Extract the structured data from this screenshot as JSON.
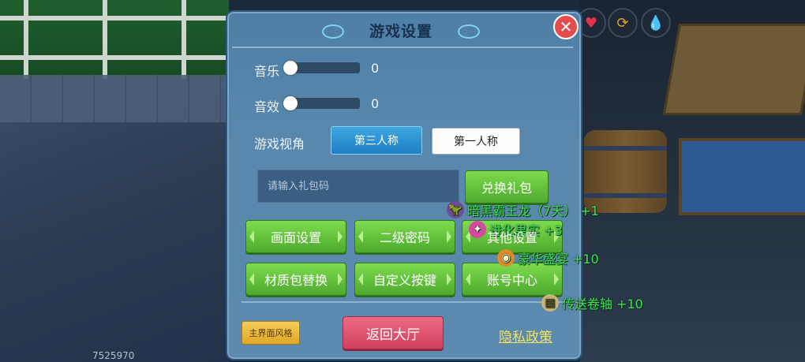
{
  "background": {
    "code_text": "7525970"
  },
  "hud": {
    "icons": [
      "heart-icon",
      "swap-icon",
      "drop-icon"
    ]
  },
  "dialog": {
    "title": "游戏设置",
    "close_symbol": "✕",
    "music": {
      "label": "音乐",
      "value": "0",
      "level": 0
    },
    "sound": {
      "label": "音效",
      "value": "0",
      "level": 0
    },
    "view": {
      "label": "游戏视角",
      "options": [
        "第三人称",
        "第一人称"
      ],
      "selected": "第三人称"
    },
    "gift": {
      "placeholder": "请输入礼包码",
      "value": "",
      "redeem_label": "兑换礼包"
    },
    "buttons": {
      "row1": [
        "画面设置",
        "二级密码",
        "其他设置"
      ],
      "row2": [
        "材质包替换",
        "自定义按键",
        "账号中心"
      ]
    },
    "footer": {
      "style_label": "主界面风格",
      "back_label": "返回大厅",
      "privacy_label": "隐私政策"
    }
  },
  "rewards": [
    {
      "text": "暗黑霸王龙（7天） +1",
      "icon": "dragon-icon"
    },
    {
      "text": "进化果实 +3",
      "icon": "fruit-icon"
    },
    {
      "text": "豪华盛宴 +10",
      "icon": "feast-icon"
    },
    {
      "text": "传送卷轴 +10",
      "icon": "scroll-icon"
    }
  ],
  "colors": {
    "panel": "#5a88ad",
    "green_button": "#5dbb36",
    "active_tab": "#2a8fd0",
    "back_button": "#dc4e6c",
    "reward_text": "#3ee05f",
    "privacy_text": "#f4e25d"
  }
}
